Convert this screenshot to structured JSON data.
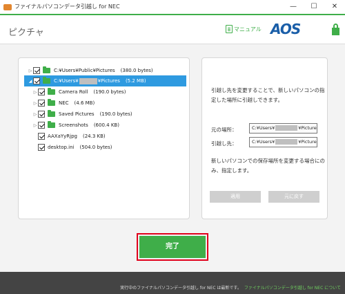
{
  "window": {
    "title": "ファイナルパソコンデータ引越し for NEC",
    "min": "—",
    "max": "☐",
    "close": "✕"
  },
  "header": {
    "page_title": "ピクチャ",
    "manual_label": "マニュアル",
    "logo": "AOS"
  },
  "tree": {
    "items": [
      {
        "label": "C:¥Users¥Public¥Pictures",
        "size": "(380.0 bytes)"
      },
      {
        "label_pre": "C:¥Users¥",
        "label_post": "¥Pictures",
        "size": "(5.2 MB)"
      },
      {
        "label": "Camera Roll",
        "size": "(190.0 bytes)"
      },
      {
        "label": "NEC",
        "size": "(4.6 MB)"
      },
      {
        "label": "Saved Pictures",
        "size": "(190.0 bytes)"
      },
      {
        "label": "Screenshots",
        "size": "(600.4 KB)"
      },
      {
        "label": "AAXaYyRjpg",
        "size": "(24.3 KB)"
      },
      {
        "label": "desktop.ini",
        "size": "(504.0 bytes)"
      }
    ]
  },
  "side": {
    "description": "引越し先を変更することで、新しいパソコンの指定した場所に引越しできます。",
    "source_label": "元の場所：",
    "source_pre": "C:¥Users¥",
    "source_post": "¥Pictures",
    "dest_label": "引越し先：",
    "dest_pre": "C:¥Users¥",
    "dest_post": "¥Pictures",
    "note": "新しいパソコンでの保存場所を変更する場合にのみ、指定します。",
    "apply_label": "適用",
    "revert_label": "元に戻す"
  },
  "done_label": "完了",
  "footer": {
    "status": "実行中のファイナルパソコンデータ引越し for NEC は最新です。",
    "link": "ファイナルパソコンデータ引越し for NEC について"
  },
  "colors": {
    "accent": "#3fae49",
    "selection": "#2e9ae0",
    "highlight_border": "#e0001b",
    "logo": "#1a5ea8"
  }
}
